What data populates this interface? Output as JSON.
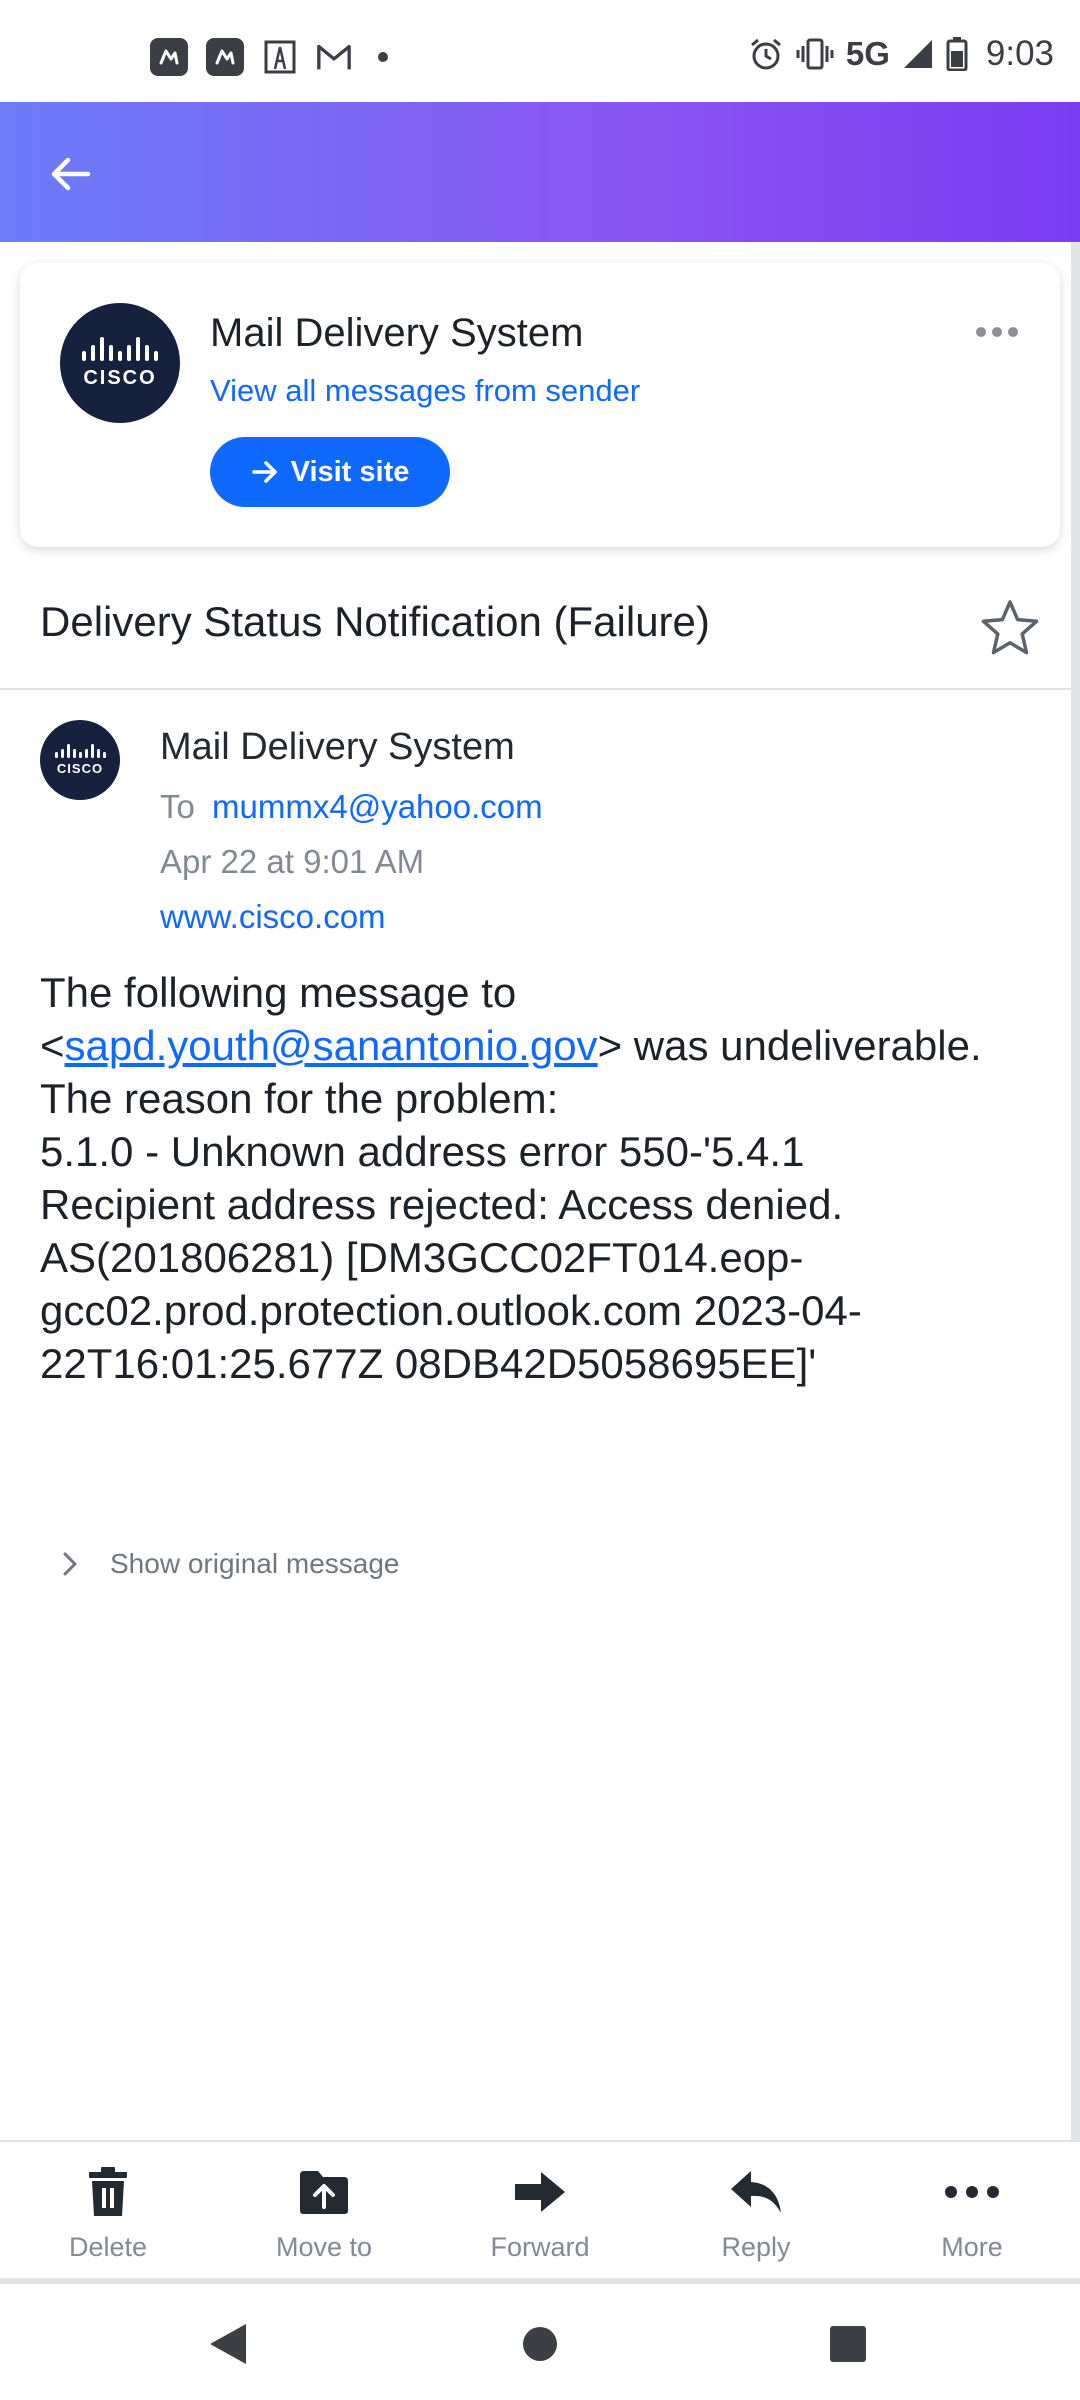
{
  "status_bar": {
    "network": "5G",
    "time": "9:03",
    "icons": [
      "app-icon",
      "app-icon",
      "tower-app-icon",
      "gmail-icon",
      "dot-icon",
      "alarm-icon",
      "vibrate-icon",
      "signal-icon",
      "battery-icon"
    ]
  },
  "header": {
    "back_icon": "back-arrow-icon"
  },
  "sender_card": {
    "logo_text": "CISCO",
    "name": "Mail Delivery System",
    "view_all": "View all messages from sender",
    "visit_site": "Visit site",
    "more_icon": "more-horizontal-icon"
  },
  "subject": "Delivery Status Notification (Failure)",
  "message": {
    "avatar_text": "CISCO",
    "from": "Mail Delivery System",
    "to_label": "To",
    "to_address": "mummx4@yahoo.com",
    "date": "Apr 22 at 9:01 AM",
    "site": "www.cisco.com",
    "body": {
      "line1": "The following message to",
      "link_prefix": "<",
      "link": "sapd.youth@sanantonio.gov",
      "link_suffix": "> was undeliverable.",
      "line3": "The reason for the problem:",
      "line4": "5.1.0 - Unknown address error 550-'5.4.1",
      "line5": "Recipient address rejected: Access denied.",
      "line6": "AS(201806281) [DM3GCC02FT014.eop-",
      "line7": "gcc02.prod.protection.outlook.com 2023-04-",
      "line8": "22T16:01:25.677Z 08DB42D5058695EE]'"
    },
    "show_original": "Show original message"
  },
  "toolbar": {
    "delete": "Delete",
    "move_to": "Move to",
    "forward": "Forward",
    "reply": "Reply",
    "more": "More"
  },
  "colors": {
    "header_gradient_start": "#6c7cf7",
    "header_gradient_end": "#7a3cf0",
    "accent_blue": "#0f69ff",
    "logo_navy": "#16213e"
  }
}
